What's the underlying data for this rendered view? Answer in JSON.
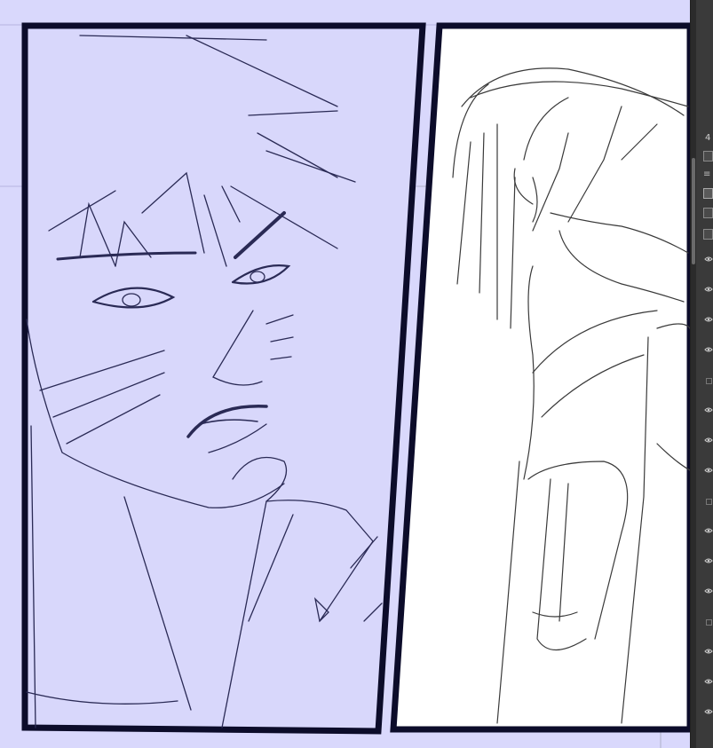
{
  "canvas": {
    "background_color": "#d9d8fc",
    "panel_left_fill": "#d8d7fb",
    "panel_right_fill": "#ffffff",
    "border_color": "#0c0c2a",
    "left_sketch_color": "#2a2a55",
    "right_sketch_color": "#3a3a3a"
  },
  "layer_panel": {
    "opacity_value": "4",
    "visible_rows": 16
  }
}
